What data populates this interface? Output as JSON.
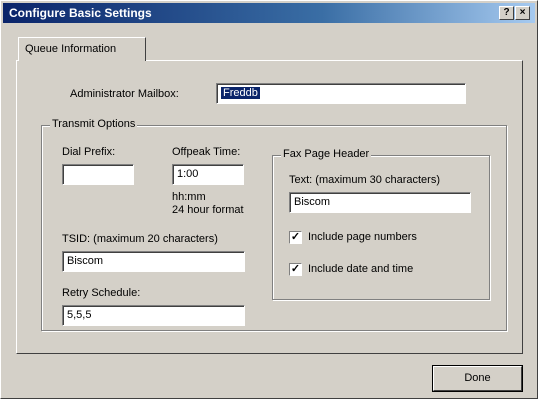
{
  "window": {
    "title": "Configure Basic Settings",
    "help_glyph": "?",
    "close_glyph": "×"
  },
  "tabs": [
    {
      "label": "Queue Information",
      "active": true
    }
  ],
  "queue": {
    "admin_mailbox_label": "Administrator Mailbox:",
    "admin_mailbox_value": "Freddb"
  },
  "transmit": {
    "group_label": "Transmit Options",
    "dial_prefix_label": "Dial Prefix:",
    "dial_prefix_value": "",
    "offpeak_label": "Offpeak Time:",
    "offpeak_value": "1:00",
    "offpeak_hint_1": "hh:mm",
    "offpeak_hint_2": "24 hour format",
    "tsid_label": "TSID: (maximum 20 characters)",
    "tsid_value": "Biscom",
    "retry_label": "Retry Schedule:",
    "retry_value": "5,5,5"
  },
  "fax_header": {
    "group_label": "Fax Page Header",
    "text_label": "Text: (maximum 30 characters)",
    "text_value": "Biscom",
    "include_page_numbers_label": "Include page numbers",
    "include_page_numbers_checked": true,
    "include_date_time_label": "Include date and time",
    "include_date_time_checked": true,
    "check_glyph": "✓"
  },
  "buttons": {
    "done_label": "Done"
  }
}
